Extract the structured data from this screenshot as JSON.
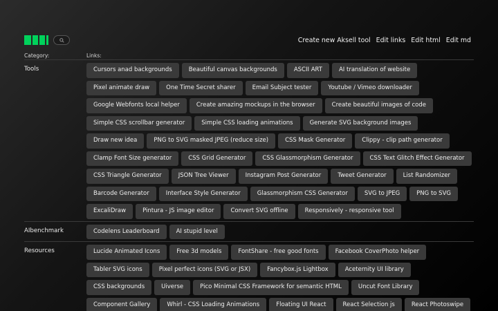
{
  "nav": [
    "Create new Aksell tool",
    "Edit links",
    "Edit html",
    "Edit md"
  ],
  "columns": {
    "category": "Category:",
    "links": "Links:"
  },
  "icons": {
    "search": "search-icon"
  },
  "colors": {
    "logo": "#00d25b",
    "button": "#3a3a3a"
  },
  "sections": [
    {
      "category": "Tools",
      "links": [
        "Cursors anad backgrounds",
        "Beautiful canvas backgrounds",
        "ASCII ART",
        "AI translation of website",
        "Pixel animate draw",
        "One Time Secret sharer",
        "Email Subject tester",
        "Youtube / Vimeo downloader",
        "Google Webfonts local helper",
        "Create amazing mockups in the browser",
        "Create beautiful images of code",
        "Simple CSS scrollbar generator",
        "Simple CSS loading animations",
        "Generate SVG background images",
        "Draw new idea",
        "PNG to SVG masked JPEG (reduce size)",
        "CSS Mask Generator",
        "Clippy - clip path generator",
        "Clamp Font Size generator",
        "CSS Grid Generator",
        "CSS Glassmorphism Generator",
        "CSS Text Glitch Effect Generator",
        "CSS Triangle Generator",
        "JSON Tree Viewer",
        "Instagram Post Generator",
        "Tweet Generator",
        "List Randomizer",
        "Barcode Generator",
        "Interface Style Generator",
        "Glassmorphism CSS Generator",
        "SVG to JPEG",
        "PNG to SVG",
        "ExcaliDraw",
        "Pintura - JS image editor",
        "Convert SVG offline",
        "Responsively - responsive tool"
      ]
    },
    {
      "category": "AIbenchmark",
      "links": [
        "Codelens Leaderboard",
        "AI stupid level"
      ]
    },
    {
      "category": "Resources",
      "links": [
        "Lucide Animated Icons",
        "Free 3d models",
        "FontShare - free good fonts",
        "Facebook CoverPhoto helper",
        "Tabler SVG icons",
        "Pixel perfect icons (SVG or JSX)",
        "Fancybox.js Lightbox",
        "Aceternity UI library",
        "CSS backgrounds",
        "Uiverse",
        "Pico Minimal CSS Framework for semantic HTML",
        "Uncut Font Library",
        "Component Gallery",
        "Whirl - CSS Loading Animations",
        "Floating UI React",
        "React Selection js",
        "React Photoswipe"
      ]
    }
  ]
}
